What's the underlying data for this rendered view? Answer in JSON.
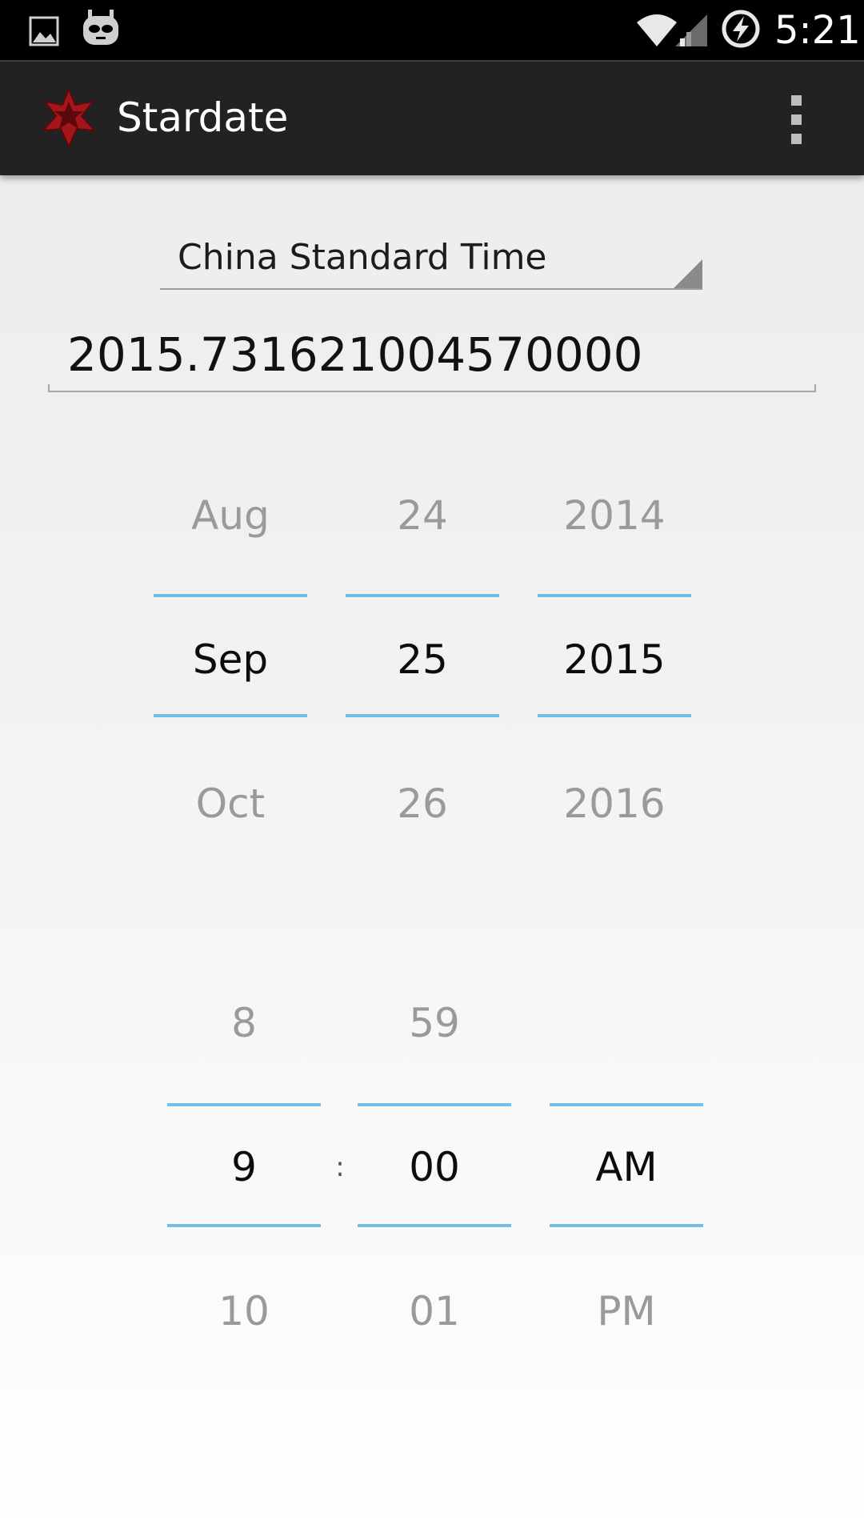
{
  "status_bar": {
    "left_icons": [
      "gallery-icon",
      "cyanogenmod-icon"
    ],
    "right_icons": [
      "wifi-icon",
      "signal-icon",
      "battery-charging-icon"
    ],
    "time": "5:21"
  },
  "action_bar": {
    "app_icon": "star-icon",
    "title": "Stardate",
    "overflow_icon": "overflow-menu-icon"
  },
  "timezone": {
    "selected": "China Standard Time"
  },
  "stardate": {
    "value": "2015.731621004570000"
  },
  "date_picker": {
    "month": {
      "prev": "Aug",
      "current": "Sep",
      "next": "Oct"
    },
    "day": {
      "prev": "24",
      "current": "25",
      "next": "26"
    },
    "year": {
      "prev": "2014",
      "current": "2015",
      "next": "2016"
    }
  },
  "time_picker": {
    "hour": {
      "prev": "8",
      "current": "9",
      "next": "10"
    },
    "separator": ":",
    "minute": {
      "prev": "59",
      "current": "00",
      "next": "01"
    },
    "ampm": {
      "prev": "",
      "current": "AM",
      "next": "PM"
    }
  },
  "colors": {
    "accent_divider": "#6ec1e4",
    "action_bar": "#222222",
    "status_bar": "#000000",
    "app_icon": "#b31b1b"
  }
}
